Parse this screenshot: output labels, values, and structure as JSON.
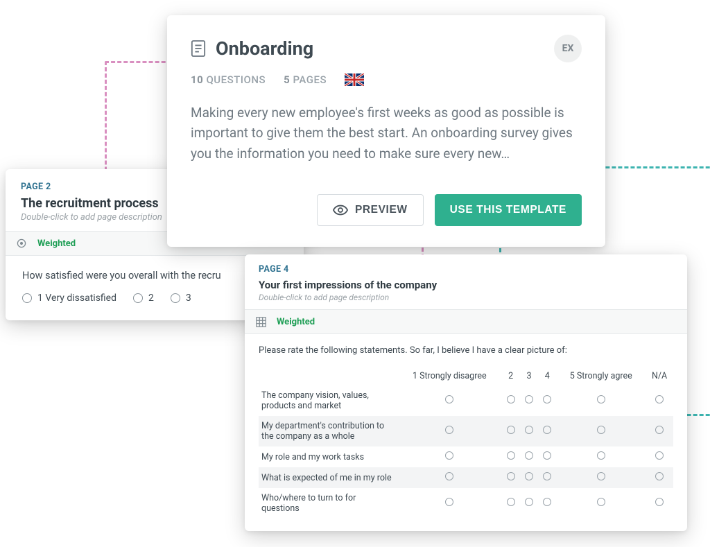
{
  "template": {
    "title": "Onboarding",
    "badge": "EX",
    "questions_count": "10",
    "questions_label": "QUESTIONS",
    "pages_count": "5",
    "pages_label": "PAGES",
    "description": "Making every new employee's first weeks as good as possible is important to give them the best start. An onboarding survey gives you the information you need to make sure every new…",
    "preview_label": "PREVIEW",
    "use_label": "USE THIS TEMPLATE"
  },
  "page2": {
    "page_label": "PAGE 2",
    "title": "The recruitment process",
    "subtitle": "Double-click to add page description",
    "weighted": "Weighted",
    "question": "How satisfied were you overall with the recru",
    "options": [
      "1 Very dissatisfied",
      "2",
      "3"
    ]
  },
  "page4": {
    "page_label": "PAGE 4",
    "title": "Your first impressions of the company",
    "subtitle": "Double-click to add page description",
    "weighted": "Weighted",
    "question": "Please rate the following statements. So far, I believe I have a clear picture of:",
    "columns": [
      "1 Strongly disagree",
      "2",
      "3",
      "4",
      "5 Strongly agree",
      "N/A"
    ],
    "rows": [
      "The company vision, values, products and market",
      "My department's contribution to the company as a whole",
      "My role and my work tasks",
      "What is expected of me in my role",
      "Who/where to turn to for questions"
    ]
  }
}
